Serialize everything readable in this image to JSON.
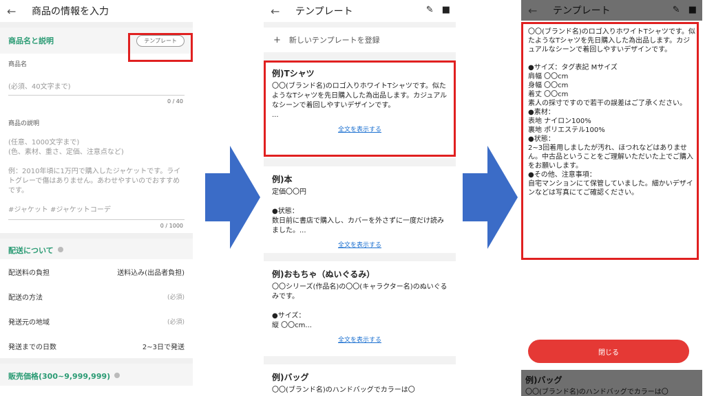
{
  "screen1": {
    "title": "商品の情報を入力",
    "section1_title": "商品名と説明",
    "template_button": "テンプレート",
    "name_label": "商品名",
    "name_placeholder": "(必須、40文字まで)",
    "name_count": "0 / 40",
    "desc_label": "商品の説明",
    "desc_placeholder": "(任意、1000文字まで)\n(色、素材、重さ、定価、注意点など)",
    "desc_example": "例：2010年頃に1万円で購入したジャケットです。ライトグレーで傷はありません。あわせやすいのでおすすめです。",
    "desc_tags": "#ジャケット #ジャケットコーデ",
    "desc_count": "0 / 1000",
    "shipping_title": "配送について",
    "rows": [
      {
        "label": "配送料の負担",
        "value": "送料込み(出品者負担)"
      },
      {
        "label": "配送の方法",
        "value": "(必須)"
      },
      {
        "label": "発送元の地域",
        "value": "(必須)"
      },
      {
        "label": "発送までの日数",
        "value": "2~3日で発送"
      }
    ],
    "price_title": "販売価格(300~9,999,999)"
  },
  "screen2": {
    "title": "テンプレート",
    "new_template": "新しいテンプレートを登録",
    "show_full": "全文を表示する",
    "cards": [
      {
        "title": "例)Tシャツ",
        "body": "〇〇(ブランド名)のロゴ入りホワイトTシャツです。似たようなTシャツを先日購入した為出品します。カジュアルなシーンで着回しやすいデザインです。\n..."
      },
      {
        "title": "例)本",
        "body": "定価〇〇円\n\n●状態：\n数日前に書店で購入し、カバーを外さずに一度だけ読みました。..."
      },
      {
        "title": "例)おもちゃ（ぬいぐるみ）",
        "body": "〇〇シリーズ(作品名)の〇〇(キャラクター名)のぬいぐるみです。\n\n●サイズ：\n縦 〇〇cm..."
      },
      {
        "title": "例)バッグ",
        "body": "〇〇(ブランド名)のハンドバッグでカラーは〇"
      }
    ]
  },
  "screen3": {
    "title": "テンプレート",
    "full_text": "〇〇(ブランド名)のロゴ入りホワイトTシャツです。似たようなTシャツを先日購入した為出品します。カジュアルなシーンで着回しやすいデザインです。\n\n●サイズ：タグ表記 Mサイズ\n肩幅 〇〇cm\n身幅 〇〇cm\n着丈 〇〇cm\n素人の採寸ですので若干の誤差はご了承ください。\n●素材：\n表地 ナイロン100%\n裏地 ポリエステル100%\n●状態：\n2~3回着用しましたが汚れ、ほつれなどはありません。中古品ということをご理解いただいた上でご購入をお願いします。\n●その他、注意事項：\n自宅マンションにて保管していました。細かいデザインなどは写真にてご確認ください。",
    "close_button": "閉じる",
    "under_title": "例)バッグ",
    "under_body": "〇〇(ブランド名)のハンドバッグでカラーは〇"
  },
  "colors": {
    "accent_green": "#2b9b74",
    "highlight_red": "#e02020",
    "arrow_blue": "#3b6cc7",
    "link_blue": "#1a6fd0",
    "button_red": "#e53935"
  },
  "icons": [
    "back-arrow-icon",
    "edit-pencil-icon",
    "trash-icon",
    "plus-icon",
    "info-icon",
    "flow-arrow-icon"
  ]
}
